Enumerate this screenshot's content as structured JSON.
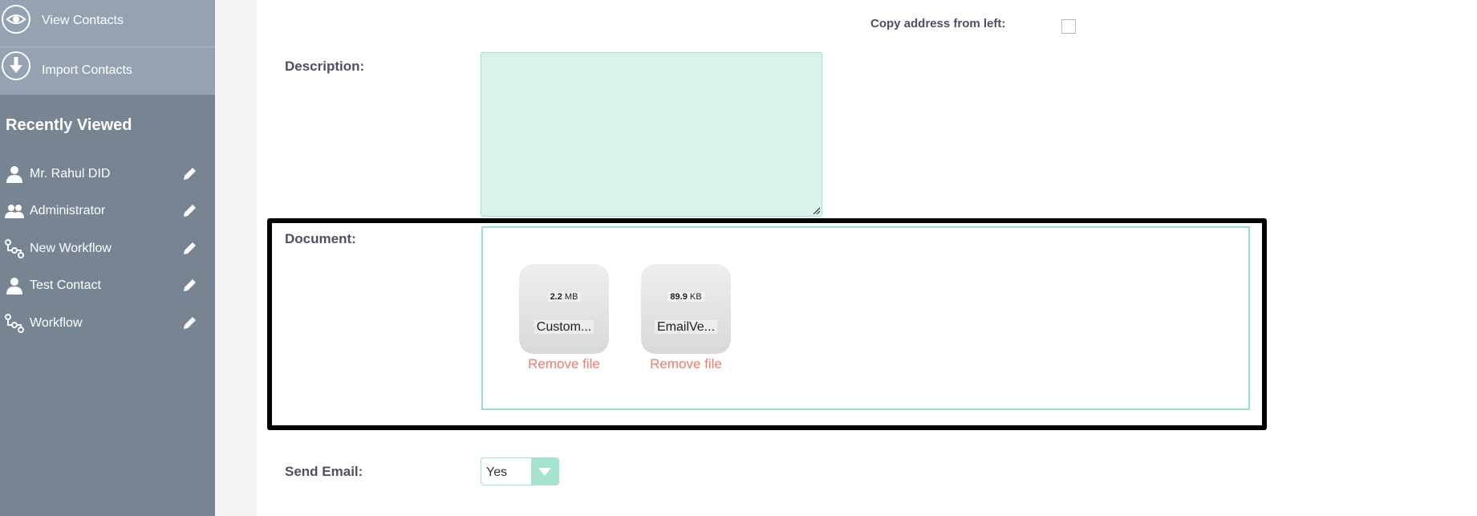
{
  "sidebar": {
    "actions": [
      {
        "label": "View Contacts",
        "icon": "eye-icon"
      },
      {
        "label": "Import Contacts",
        "icon": "download-icon"
      }
    ],
    "recently_viewed_title": "Recently Viewed",
    "recent_items": [
      {
        "label": "Mr. Rahul DID",
        "icon": "person-icon"
      },
      {
        "label": "Administrator",
        "icon": "users-icon"
      },
      {
        "label": "New Workflow",
        "icon": "workflow-icon"
      },
      {
        "label": "Test Contact",
        "icon": "person-icon"
      },
      {
        "label": "Workflow",
        "icon": "workflow-icon"
      }
    ]
  },
  "form": {
    "copy_address_label": "Copy address from left:",
    "description_label": "Description:",
    "description_value": "",
    "document_label": "Document:",
    "files": [
      {
        "size_num": "2.2",
        "size_unit": "MB",
        "name": "Custom...",
        "remove_label": "Remove file"
      },
      {
        "size_num": "89.9",
        "size_unit": "KB",
        "name": "EmailVe...",
        "remove_label": "Remove file"
      }
    ],
    "send_email_label": "Send Email:",
    "send_email_value": "Yes"
  },
  "colors": {
    "sidebar_bg": "#778592",
    "sidebar_action_bg": "#94a2b2",
    "accent_mint": "#a5e2cf",
    "remove_link": "#f07b70",
    "label_text": "#534d64"
  }
}
